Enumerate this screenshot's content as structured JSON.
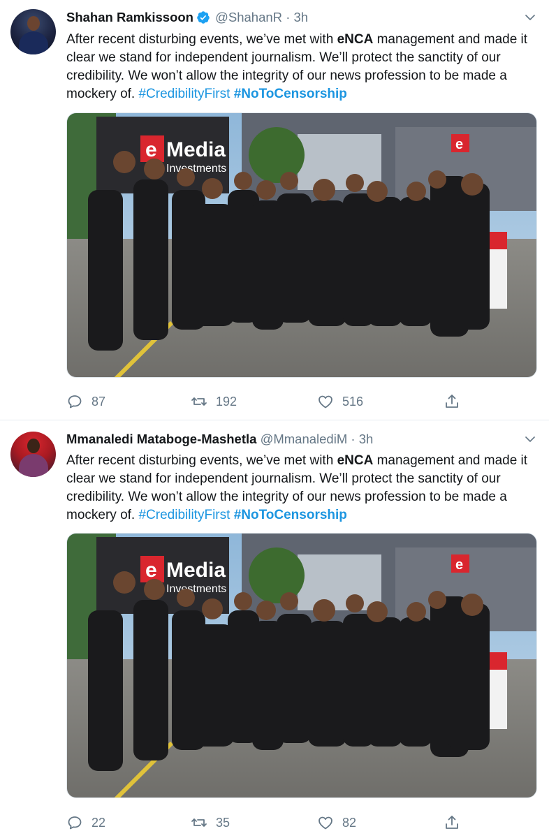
{
  "tweets": [
    {
      "author": {
        "name": "Shahan Ramkissoon",
        "handle": "@ShahanR",
        "verified": true
      },
      "separator": "·",
      "time": "3h",
      "text": {
        "p1": "After recent disturbing events, we’ve met with ",
        "bold": "eNCA",
        "p2": " management and made it clear we stand for independent journalism. We’ll protect the sanctity of our credibility. We won’t allow the integrity of our news profession to be made a mockery of. ",
        "hashtag1": "#CredibilityFirst",
        "hashtag2": "#NoToCensorship"
      },
      "photo": {
        "sign_top": "Media",
        "sign_bottom": "Investments",
        "sign_logo": "e"
      },
      "stats": {
        "replies": "87",
        "retweets": "192",
        "likes": "516"
      }
    },
    {
      "author": {
        "name": "Mmanaledi Mataboge-Mashetla",
        "handle": "@MmanalediM",
        "verified": false
      },
      "separator": "·",
      "time": "3h",
      "text": {
        "p1": "After recent disturbing events, we’ve met with ",
        "bold": "eNCA",
        "p2": " management and made it clear we stand for independent journalism. We’ll protect the sanctity of our credibility. We won’t allow the integrity of our news profession to be made a mockery of. ",
        "hashtag1": "#CredibilityFirst",
        "hashtag2": "#NoToCensorship"
      },
      "photo": {
        "sign_top": "Media",
        "sign_bottom": "Investments",
        "sign_logo": "e"
      },
      "stats": {
        "replies": "22",
        "retweets": "35",
        "likes": "82"
      }
    }
  ],
  "icons": {
    "verified": "verified-badge-icon",
    "more": "chevron-down-icon",
    "reply": "reply-icon",
    "retweet": "retweet-icon",
    "like": "heart-icon",
    "share": "share-icon"
  },
  "colors": {
    "text": "#14171a",
    "muted": "#657786",
    "link": "#1b95e0",
    "divider": "#e6ecf0"
  }
}
